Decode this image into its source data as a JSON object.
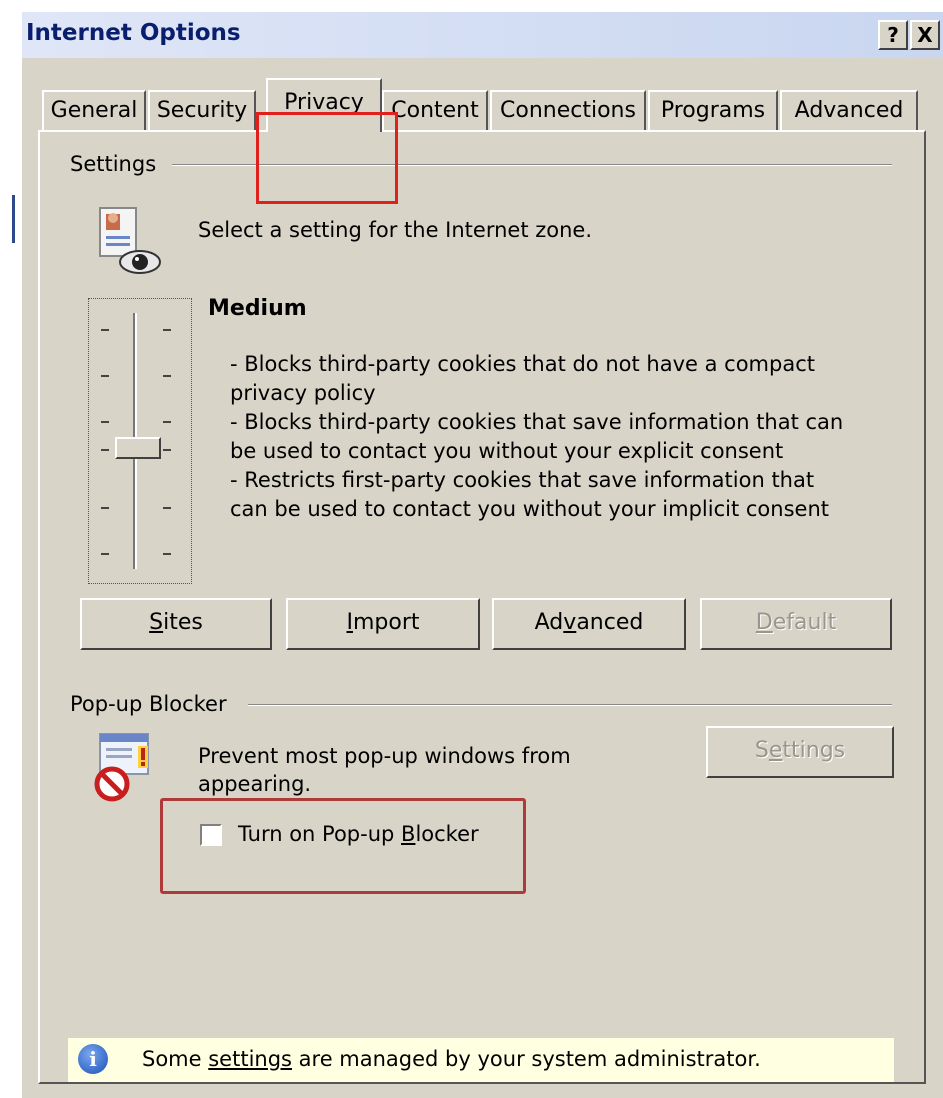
{
  "window": {
    "title": "Internet Options",
    "help_glyph": "?",
    "close_glyph": "X"
  },
  "tabs": [
    {
      "label": "General",
      "active": false
    },
    {
      "label": "Security",
      "active": false
    },
    {
      "label": "Privacy",
      "active": true
    },
    {
      "label": "Content",
      "active": false
    },
    {
      "label": "Connections",
      "active": false
    },
    {
      "label": "Programs",
      "active": false
    },
    {
      "label": "Advanced",
      "active": false
    }
  ],
  "settings": {
    "group_label": "Settings",
    "zone_text": "Select a setting for the Internet zone.",
    "level": "Medium",
    "level_fraction": 0.6,
    "description": [
      "- Blocks third-party cookies that do not have a compact",
      "privacy policy",
      "- Blocks third-party cookies that save information that can",
      "be used to contact you without your explicit consent",
      "- Restricts first-party cookies that save information that",
      "can be used to contact you without your implicit consent"
    ],
    "buttons": {
      "sites": {
        "pre": "",
        "u": "S",
        "post": "ites"
      },
      "import": {
        "pre": "",
        "u": "I",
        "post": "mport"
      },
      "advanced": {
        "pre": "Ad",
        "u": "v",
        "post": "anced"
      },
      "default": {
        "pre": "",
        "u": "D",
        "post": "efault"
      }
    }
  },
  "popup": {
    "group_label": "Pop-up Blocker",
    "text_line1": "Prevent most pop-up windows from",
    "text_line2": "appearing.",
    "settings_button": {
      "pre": "S",
      "u": "e",
      "post": "ttings"
    },
    "checkbox": {
      "pre": "Turn on Pop-up ",
      "u": "B",
      "post": "locker",
      "checked": false
    }
  },
  "admin": {
    "icon_glyph": "i",
    "pre": "Some ",
    "link": "settings",
    "post": " are managed by your system administrator."
  },
  "colors": {
    "highlight": "#e0201c",
    "dialog_bg": "#d8d4c8",
    "info_bar": "#ffffe1"
  }
}
